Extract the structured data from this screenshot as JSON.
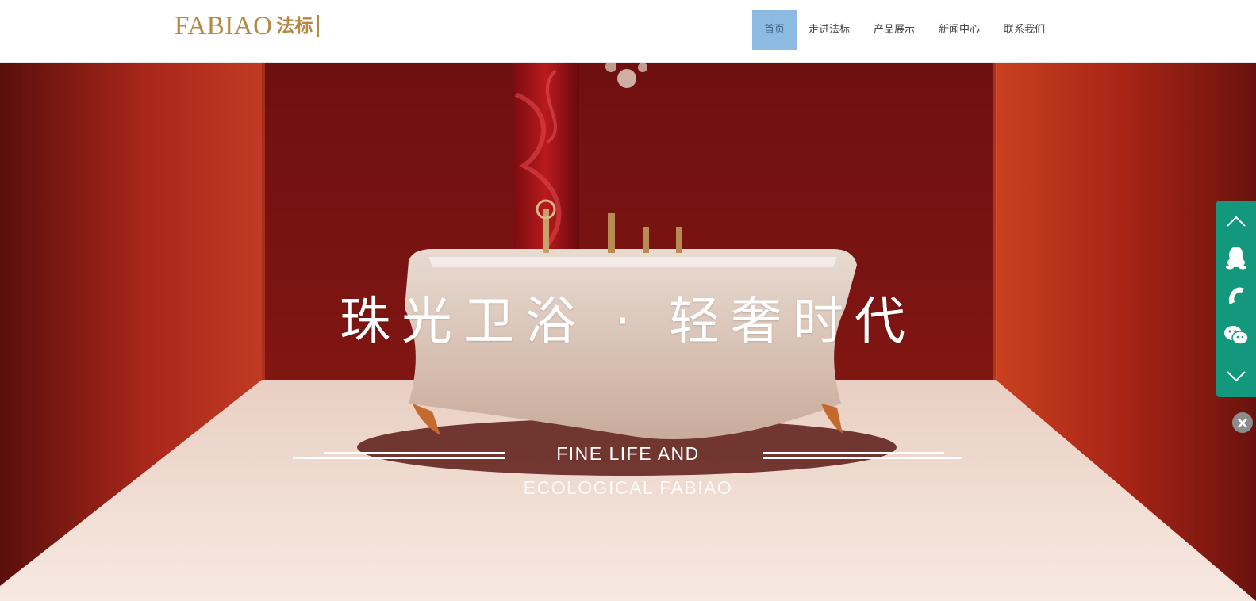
{
  "brand": {
    "logo_text": "FABIAO",
    "logo_cn": "法标",
    "color": "#b48a43"
  },
  "nav": {
    "items": [
      {
        "label": "首页",
        "active": true
      },
      {
        "label": "走进法标",
        "active": false
      },
      {
        "label": "产品展示",
        "active": false
      },
      {
        "label": "新闻中心",
        "active": false
      },
      {
        "label": "联系我们",
        "active": false
      }
    ],
    "active_bg": "#8ebbe2"
  },
  "hero": {
    "title": "珠光卫浴 · 轻奢时代",
    "subtitle_line1": "FINE LIFE AND",
    "subtitle_line2": "ECOLOGICAL FABIAO",
    "wall_color": "#b02a18",
    "floor_color": "#f1ddd3"
  },
  "side_bar": {
    "color": "#13987d",
    "buttons": [
      {
        "icon": "chevron-up-icon"
      },
      {
        "icon": "qq-icon"
      },
      {
        "icon": "phone-icon"
      },
      {
        "icon": "wechat-icon"
      },
      {
        "icon": "chevron-down-icon"
      }
    ],
    "close_icon": "close-icon",
    "close_glyph": "×"
  }
}
